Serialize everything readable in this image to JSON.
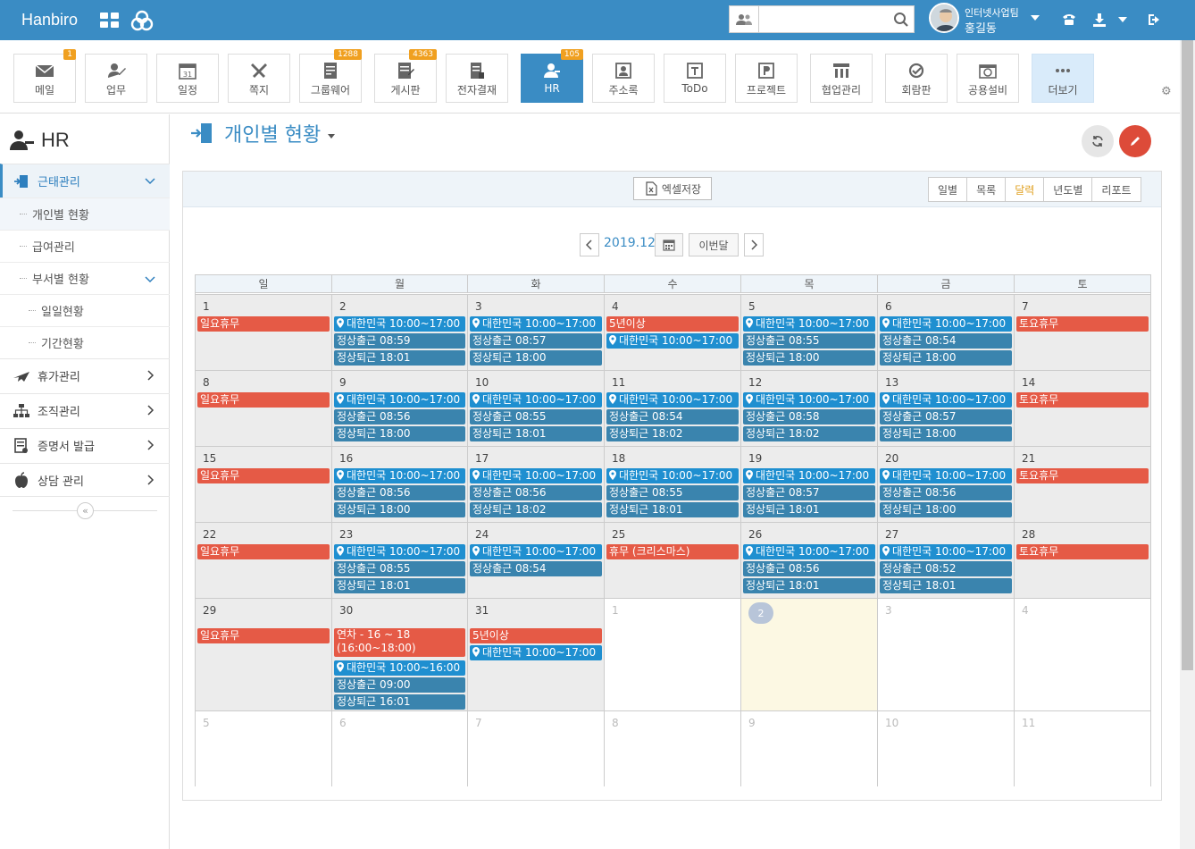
{
  "topbar": {
    "brand": "Hanbiro",
    "search_placeholder": "",
    "user_team": "인터넷사업팀",
    "user_name": "홍길동"
  },
  "apps": [
    {
      "label": "메일",
      "icon": "mail-icon",
      "badge": "1"
    },
    {
      "label": "업무",
      "icon": "task-icon",
      "badge": ""
    },
    {
      "label": "일정",
      "icon": "calendar-icon",
      "badge": ""
    },
    {
      "label": "쪽지",
      "icon": "note-icon",
      "badge": ""
    },
    {
      "label": "그룹웨어",
      "icon": "groupware-icon",
      "badge": "1288"
    },
    {
      "label": "게시판",
      "icon": "board-icon",
      "badge": "4363"
    },
    {
      "label": "전자결재",
      "icon": "approval-icon",
      "badge": ""
    },
    {
      "label": "HR",
      "icon": "hr-icon",
      "badge": "105"
    },
    {
      "label": "주소록",
      "icon": "address-icon",
      "badge": ""
    },
    {
      "label": "ToDo",
      "icon": "todo-icon",
      "badge": ""
    },
    {
      "label": "프로젝트",
      "icon": "project-icon",
      "badge": ""
    },
    {
      "label": "협업관리",
      "icon": "collab-icon",
      "badge": ""
    },
    {
      "label": "회람판",
      "icon": "circular-icon",
      "badge": ""
    },
    {
      "label": "공용설비",
      "icon": "facility-icon",
      "badge": ""
    },
    {
      "label": "더보기",
      "icon": "more-icon",
      "badge": ""
    }
  ],
  "sidebar": {
    "title": "HR",
    "attendance": "근태관리",
    "personal_status": "개인별 현황",
    "payroll": "급여관리",
    "dept_status": "부서별 현황",
    "daily_status": "일일현황",
    "period_status": "기간현황",
    "leave": "휴가관리",
    "org": "조직관리",
    "certificate": "증명서 발급",
    "counsel": "상담 관리"
  },
  "main": {
    "title": "개인별 현황",
    "excel_label": "엑셀저장",
    "view_tabs": [
      "일별",
      "목록",
      "달력",
      "년도별",
      "리포트"
    ],
    "active_view": "달력",
    "month": "2019.12",
    "this_month": "이번달"
  },
  "calendar": {
    "weekdays": [
      "일",
      "월",
      "화",
      "수",
      "목",
      "금",
      "토"
    ],
    "weeks": [
      [
        {
          "day": "1",
          "other": false,
          "events": [
            {
              "type": "red",
              "text": "일요휴무"
            }
          ]
        },
        {
          "day": "2",
          "other": false,
          "events": [
            {
              "type": "blue",
              "text": "대한민국 10:00~17:00",
              "pin": true
            },
            {
              "type": "teal",
              "text": "정상출근 08:59"
            },
            {
              "type": "teal",
              "text": "정상퇴근 18:01"
            }
          ]
        },
        {
          "day": "3",
          "other": false,
          "events": [
            {
              "type": "blue",
              "text": "대한민국 10:00~17:00",
              "pin": true
            },
            {
              "type": "teal",
              "text": "정상출근 08:57"
            },
            {
              "type": "teal",
              "text": "정상퇴근 18:00"
            }
          ]
        },
        {
          "day": "4",
          "other": false,
          "events": [
            {
              "type": "red",
              "text": "5년이상"
            },
            {
              "type": "blue",
              "text": "대한민국 10:00~17:00",
              "pin": true
            }
          ]
        },
        {
          "day": "5",
          "other": false,
          "events": [
            {
              "type": "blue",
              "text": "대한민국 10:00~17:00",
              "pin": true
            },
            {
              "type": "teal",
              "text": "정상출근 08:55"
            },
            {
              "type": "teal",
              "text": "정상퇴근 18:00"
            }
          ]
        },
        {
          "day": "6",
          "other": false,
          "events": [
            {
              "type": "blue",
              "text": "대한민국 10:00~17:00",
              "pin": true
            },
            {
              "type": "teal",
              "text": "정상출근 08:54"
            },
            {
              "type": "teal",
              "text": "정상퇴근 18:00"
            }
          ]
        },
        {
          "day": "7",
          "other": false,
          "events": [
            {
              "type": "red",
              "text": "토요휴무"
            }
          ]
        }
      ],
      [
        {
          "day": "8",
          "other": false,
          "events": [
            {
              "type": "red",
              "text": "일요휴무"
            }
          ]
        },
        {
          "day": "9",
          "other": false,
          "events": [
            {
              "type": "blue",
              "text": "대한민국 10:00~17:00",
              "pin": true
            },
            {
              "type": "teal",
              "text": "정상출근 08:56"
            },
            {
              "type": "teal",
              "text": "정상퇴근 18:00"
            }
          ]
        },
        {
          "day": "10",
          "other": false,
          "events": [
            {
              "type": "blue",
              "text": "대한민국 10:00~17:00",
              "pin": true
            },
            {
              "type": "teal",
              "text": "정상출근 08:55"
            },
            {
              "type": "teal",
              "text": "정상퇴근 18:01"
            }
          ]
        },
        {
          "day": "11",
          "other": false,
          "events": [
            {
              "type": "blue",
              "text": "대한민국 10:00~17:00",
              "pin": true
            },
            {
              "type": "teal",
              "text": "정상출근 08:54"
            },
            {
              "type": "teal",
              "text": "정상퇴근 18:02"
            }
          ]
        },
        {
          "day": "12",
          "other": false,
          "events": [
            {
              "type": "blue",
              "text": "대한민국 10:00~17:00",
              "pin": true
            },
            {
              "type": "teal",
              "text": "정상출근 08:58"
            },
            {
              "type": "teal",
              "text": "정상퇴근 18:02"
            }
          ]
        },
        {
          "day": "13",
          "other": false,
          "events": [
            {
              "type": "blue",
              "text": "대한민국 10:00~17:00",
              "pin": true
            },
            {
              "type": "teal",
              "text": "정상출근 08:57"
            },
            {
              "type": "teal",
              "text": "정상퇴근 18:00"
            }
          ]
        },
        {
          "day": "14",
          "other": false,
          "events": [
            {
              "type": "red",
              "text": "토요휴무"
            }
          ]
        }
      ],
      [
        {
          "day": "15",
          "other": false,
          "events": [
            {
              "type": "red",
              "text": "일요휴무"
            }
          ]
        },
        {
          "day": "16",
          "other": false,
          "events": [
            {
              "type": "blue",
              "text": "대한민국 10:00~17:00",
              "pin": true
            },
            {
              "type": "teal",
              "text": "정상출근 08:56"
            },
            {
              "type": "teal",
              "text": "정상퇴근 18:00"
            }
          ]
        },
        {
          "day": "17",
          "other": false,
          "events": [
            {
              "type": "blue",
              "text": "대한민국 10:00~17:00",
              "pin": true
            },
            {
              "type": "teal",
              "text": "정상출근 08:56"
            },
            {
              "type": "teal",
              "text": "정상퇴근 18:02"
            }
          ]
        },
        {
          "day": "18",
          "other": false,
          "events": [
            {
              "type": "blue",
              "text": "대한민국 10:00~17:00",
              "pin": true
            },
            {
              "type": "teal",
              "text": "정상출근 08:55"
            },
            {
              "type": "teal",
              "text": "정상퇴근 18:01"
            }
          ]
        },
        {
          "day": "19",
          "other": false,
          "events": [
            {
              "type": "blue",
              "text": "대한민국 10:00~17:00",
              "pin": true
            },
            {
              "type": "teal",
              "text": "정상출근 08:57"
            },
            {
              "type": "teal",
              "text": "정상퇴근 18:01"
            }
          ]
        },
        {
          "day": "20",
          "other": false,
          "events": [
            {
              "type": "blue",
              "text": "대한민국 10:00~17:00",
              "pin": true
            },
            {
              "type": "teal",
              "text": "정상출근 08:56"
            },
            {
              "type": "teal",
              "text": "정상퇴근 18:00"
            }
          ]
        },
        {
          "day": "21",
          "other": false,
          "events": [
            {
              "type": "red",
              "text": "토요휴무"
            }
          ]
        }
      ],
      [
        {
          "day": "22",
          "other": false,
          "events": [
            {
              "type": "red",
              "text": "일요휴무"
            }
          ]
        },
        {
          "day": "23",
          "other": false,
          "events": [
            {
              "type": "blue",
              "text": "대한민국 10:00~17:00",
              "pin": true
            },
            {
              "type": "teal",
              "text": "정상출근 08:55"
            },
            {
              "type": "teal",
              "text": "정상퇴근 18:01"
            }
          ]
        },
        {
          "day": "24",
          "other": false,
          "events": [
            {
              "type": "blue",
              "text": "대한민국 10:00~17:00",
              "pin": true
            },
            {
              "type": "teal",
              "text": "정상출근 08:54"
            }
          ]
        },
        {
          "day": "25",
          "other": false,
          "events": [
            {
              "type": "red",
              "text": "휴무 (크리스마스)"
            }
          ]
        },
        {
          "day": "26",
          "other": false,
          "events": [
            {
              "type": "blue",
              "text": "대한민국 10:00~17:00",
              "pin": true
            },
            {
              "type": "teal",
              "text": "정상출근 08:56"
            },
            {
              "type": "teal",
              "text": "정상퇴근 18:01"
            }
          ]
        },
        {
          "day": "27",
          "other": false,
          "events": [
            {
              "type": "blue",
              "text": "대한민국 10:00~17:00",
              "pin": true
            },
            {
              "type": "teal",
              "text": "정상출근 08:52"
            },
            {
              "type": "teal",
              "text": "정상퇴근 18:01"
            }
          ]
        },
        {
          "day": "28",
          "other": false,
          "events": [
            {
              "type": "red",
              "text": "토요휴무"
            }
          ]
        }
      ],
      [
        {
          "day": "29",
          "other": false,
          "events": [
            {
              "type": "red",
              "text": "일요휴무"
            }
          ]
        },
        {
          "day": "30",
          "other": false,
          "events": [
            {
              "type": "red",
              "text": "연차 - 16 ~ 18 (16:00~18:00)",
              "tall": true
            },
            {
              "type": "blue",
              "text": "대한민국 10:00~16:00",
              "pin": true
            },
            {
              "type": "teal",
              "text": "정상출근 09:00"
            },
            {
              "type": "teal",
              "text": "정상퇴근 16:01"
            }
          ]
        },
        {
          "day": "31",
          "other": false,
          "events": [
            {
              "type": "red",
              "text": "5년이상"
            },
            {
              "type": "blue",
              "text": "대한민국 10:00~17:00",
              "pin": true
            }
          ]
        },
        {
          "day": "1",
          "other": true,
          "events": []
        },
        {
          "day": "2",
          "other": true,
          "today": true,
          "events": []
        },
        {
          "day": "3",
          "other": true,
          "events": []
        },
        {
          "day": "4",
          "other": true,
          "events": []
        }
      ],
      [
        {
          "day": "5",
          "other": true,
          "events": []
        },
        {
          "day": "6",
          "other": true,
          "events": []
        },
        {
          "day": "7",
          "other": true,
          "events": []
        },
        {
          "day": "8",
          "other": true,
          "events": []
        },
        {
          "day": "9",
          "other": true,
          "events": []
        },
        {
          "day": "10",
          "other": true,
          "events": []
        },
        {
          "day": "11",
          "other": true,
          "events": []
        }
      ]
    ]
  },
  "colors": {
    "primary": "#3a8cc4",
    "holiday": "#e55a46",
    "location": "#1f8fd0",
    "attendance": "#3a84ae",
    "active_tab": "#e0a020"
  }
}
